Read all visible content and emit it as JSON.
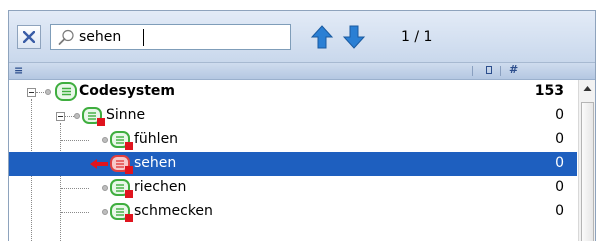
{
  "toolbar": {
    "close_icon": "close-x-icon",
    "search": {
      "icon": "magnifier-icon",
      "value": "sehen",
      "placeholder": ""
    },
    "prev_icon": "arrow-up-icon",
    "next_icon": "arrow-down-icon",
    "counter": "1 / 1"
  },
  "header": {
    "tree_icon": "tree-view-icon",
    "col1_icon": "square-icon",
    "col2_label": "#"
  },
  "tree": {
    "rows": [
      {
        "label": "Codesystem",
        "count": "153"
      },
      {
        "label": "Sinne",
        "count": "0"
      },
      {
        "label": "fühlen",
        "count": "0"
      },
      {
        "label": "sehen",
        "count": "0"
      },
      {
        "label": "riechen",
        "count": "0"
      },
      {
        "label": "schmecken",
        "count": "0"
      }
    ]
  },
  "colors": {
    "selection": "#1e5fbf",
    "code_green": "#3fae3f",
    "code_red": "#e0141e",
    "arrow_blue": "#2a7fd4"
  }
}
